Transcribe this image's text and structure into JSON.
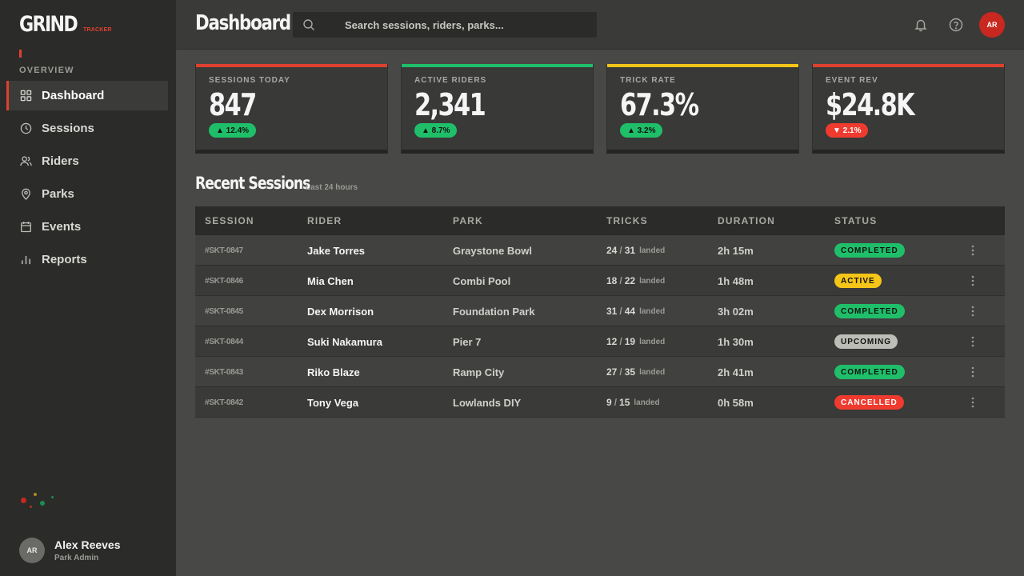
{
  "brand": {
    "name": "GRIND",
    "sub": "TRACKER",
    "accent": "#e0402f"
  },
  "sidebar": {
    "section_label": "OVERVIEW",
    "items": [
      {
        "label": "Dashboard",
        "icon": "grid-icon",
        "active": true
      },
      {
        "label": "Sessions",
        "icon": "clock-icon"
      },
      {
        "label": "Riders",
        "icon": "users-icon"
      },
      {
        "label": "Parks",
        "icon": "map-pin-icon"
      },
      {
        "label": "Events",
        "icon": "calendar-icon"
      },
      {
        "label": "Reports",
        "icon": "bar-chart-icon"
      }
    ],
    "user": {
      "initials": "AR",
      "name": "Alex Reeves",
      "role": "Park Admin"
    }
  },
  "header": {
    "title": "Dashboard",
    "search_placeholder": "Search sessions, riders, parks...",
    "avatar_initials": "AR"
  },
  "stats": [
    {
      "label": "SESSIONS TODAY",
      "value": "847",
      "delta": "▲ 12.4%",
      "trend": "up",
      "color": "#e0402f"
    },
    {
      "label": "ACTIVE RIDERS",
      "value": "2,341",
      "delta": "▲ 8.7%",
      "trend": "up",
      "color": "#1fbf6a"
    },
    {
      "label": "TRICK RATE",
      "value": "67.3%",
      "delta": "▲ 3.2%",
      "trend": "up",
      "color": "#f5c518"
    },
    {
      "label": "EVENT REV",
      "value": "$24.8K",
      "delta": "▼ 2.1%",
      "trend": "down",
      "color": "#e0402f"
    }
  ],
  "recent": {
    "title": "Recent Sessions",
    "subtitle": "Last 24 hours",
    "columns": [
      "SESSION",
      "RIDER",
      "PARK",
      "TRICKS",
      "DURATION",
      "STATUS"
    ],
    "landed_label": "landed",
    "rows": [
      {
        "id": "#SKT-0847",
        "rider": "Jake Torres",
        "park": "Graystone Bowl",
        "landed": "24",
        "total": "31",
        "duration": "2h 15m",
        "status": "COMPLETED"
      },
      {
        "id": "#SKT-0846",
        "rider": "Mia Chen",
        "park": "Combi Pool",
        "landed": "18",
        "total": "22",
        "duration": "1h 48m",
        "status": "ACTIVE"
      },
      {
        "id": "#SKT-0845",
        "rider": "Dex Morrison",
        "park": "Foundation Park",
        "landed": "31",
        "total": "44",
        "duration": "3h 02m",
        "status": "COMPLETED"
      },
      {
        "id": "#SKT-0844",
        "rider": "Suki Nakamura",
        "park": "Pier 7",
        "landed": "12",
        "total": "19",
        "duration": "1h 30m",
        "status": "UPCOMING"
      },
      {
        "id": "#SKT-0843",
        "rider": "Riko Blaze",
        "park": "Ramp City",
        "landed": "27",
        "total": "35",
        "duration": "2h 41m",
        "status": "COMPLETED"
      },
      {
        "id": "#SKT-0842",
        "rider": "Tony Vega",
        "park": "Lowlands DIY",
        "landed": "9",
        "total": "15",
        "duration": "0h 58m",
        "status": "CANCELLED"
      }
    ]
  }
}
